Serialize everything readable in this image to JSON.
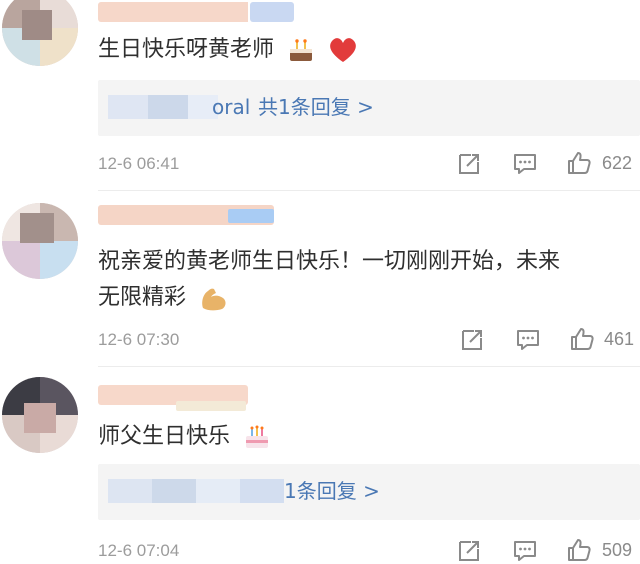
{
  "comments": [
    {
      "text": "生日快乐呀黄老师",
      "reply": {
        "visible_fragment": "oral",
        "summary": "共1条回复 >"
      },
      "timestamp": "12-6 06:41",
      "like_count": "622"
    },
    {
      "text_line1": "祝亲爱的黄老师生日快乐！一切刚刚开始，未来",
      "text_line2": "无限精彩",
      "timestamp": "12-6 07:30",
      "like_count": "461"
    },
    {
      "text": "师父生日快乐",
      "reply": {
        "summary": "1条回复 >"
      },
      "timestamp": "12-6 07:04",
      "like_count": "509"
    }
  ],
  "icons": {
    "repost": "repost-icon",
    "comment": "comment-icon",
    "like": "thumbs-up-icon",
    "cake": "birthday-cake-emoji",
    "heart": "red-heart-emoji",
    "muscle": "flexed-biceps-emoji"
  },
  "colors": {
    "link_blue": "#4a78b4",
    "reply_bg": "#f4f4f4",
    "meta_gray": "#9c9c9c",
    "text_dark": "#2f2f2f"
  }
}
